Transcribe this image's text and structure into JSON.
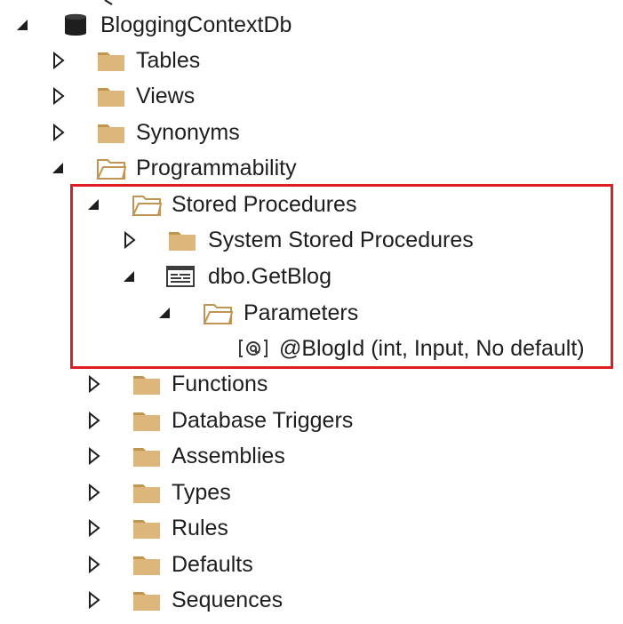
{
  "colors": {
    "folder": "#dcb67a",
    "folder_dark": "#c09552",
    "arrow": "#1e1e1e",
    "highlight": "#e01c24",
    "text": "#1e1e1e"
  },
  "tree": {
    "root": {
      "label": "BloggingContextDb",
      "icon": "database-icon",
      "expanded": true
    },
    "items": [
      {
        "label": "Tables",
        "icon": "folder-icon",
        "expanded": false
      },
      {
        "label": "Views",
        "icon": "folder-icon",
        "expanded": false
      },
      {
        "label": "Synonyms",
        "icon": "folder-icon",
        "expanded": false
      },
      {
        "label": "Programmability",
        "icon": "folder-open-icon",
        "expanded": true
      },
      {
        "label": "Stored Procedures",
        "icon": "folder-open-icon",
        "expanded": true
      },
      {
        "label": "System Stored Procedures",
        "icon": "folder-icon",
        "expanded": false
      },
      {
        "label": "dbo.GetBlog",
        "icon": "stored-procedure-icon",
        "expanded": true
      },
      {
        "label": "Parameters",
        "icon": "folder-open-icon",
        "expanded": true
      },
      {
        "label": "@BlogId (int, Input, No default)",
        "icon": "parameter-icon"
      },
      {
        "label": "Functions",
        "icon": "folder-icon",
        "expanded": false
      },
      {
        "label": "Database Triggers",
        "icon": "folder-icon",
        "expanded": false
      },
      {
        "label": "Assemblies",
        "icon": "folder-icon",
        "expanded": false
      },
      {
        "label": "Types",
        "icon": "folder-icon",
        "expanded": false
      },
      {
        "label": "Rules",
        "icon": "folder-icon",
        "expanded": false
      },
      {
        "label": "Defaults",
        "icon": "folder-icon",
        "expanded": false
      },
      {
        "label": "Sequences",
        "icon": "folder-icon",
        "expanded": false
      }
    ]
  }
}
